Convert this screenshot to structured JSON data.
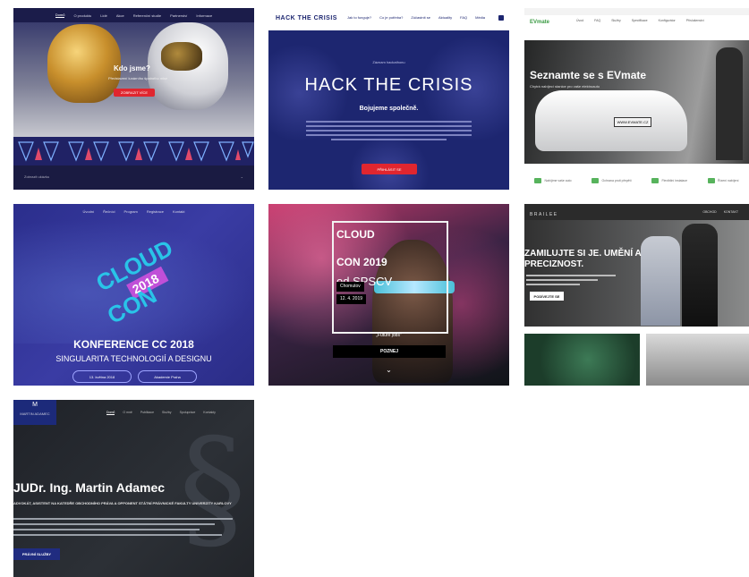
{
  "cards": [
    {
      "nav": [
        "Domů",
        "O produktu",
        "Lidé",
        "Akce",
        "Referenční studie",
        "Partnerství",
        "Informace"
      ],
      "title": "Kdo jsme?",
      "subtitle": "Představení lunárního špatného mise",
      "button": "ZOBRAZIT VÍCE",
      "footer": "Zobrazit ukázku"
    },
    {
      "logo": "HACK THE CRISIS",
      "nav": [
        "Jak to funguje?",
        "Co je potřeba?",
        "Zúčastnit se",
        "Aktuality",
        "FAQ",
        "Média"
      ],
      "kicker": "Záznam hackathonu",
      "title": "HACK THE CRISIS",
      "slogan": "Bojujeme společně.",
      "button": "PŘIHLÁSIT SE"
    },
    {
      "logo": "EVmate",
      "nav": [
        "Úvod",
        "FAQ",
        "Služby",
        "Specifikace",
        "Konfigurátor",
        "Příslušenství"
      ],
      "headline": "Seznamte se s EVmate",
      "subline": "Chytrá nabíjecí stanice pro vaše elektroauto",
      "plate": "WWW.EVMATE.CZ",
      "features": [
        "Nabíjíme vaše auto",
        "Ochrana proti přepětí",
        "Flexibilní instalace",
        "Řízení nabíjení"
      ],
      "accent": "#3a9a43"
    },
    {
      "nav": [
        "Úvodní",
        "Řečníci",
        "Program",
        "Registrace",
        "Kontakt"
      ],
      "logo_word1": "CLOUD",
      "logo_word2": "CON",
      "logo_year": "2018",
      "title": "KONFERENCE CC 2018",
      "subtitle": "SINGULARITA TECHNOLOGIÍ A DESIGNU",
      "pill1": "13. května 2018",
      "pill2": "Akademie Praha"
    },
    {
      "title1": "CLOUD",
      "title2": "CON 2019",
      "title3": "od SPSCV",
      "tag_place": "Chomutov",
      "tag_date": "12. 4. 2019",
      "quote": "„Future jobs\"",
      "button": "POZNEJ"
    },
    {
      "logo": "BRAILEE",
      "nav": [
        "OBCHOD",
        "KONTAKT"
      ],
      "headline": "ZAMILUJTE SI JE. UMĚNÍ A PRECIZNOST.",
      "button": "PODÍVEJTE SE"
    },
    {
      "logo_monogram": "M",
      "logo_name": "MARTIN ADAMEC",
      "nav": [
        "Domů",
        "O mně",
        "Publikace",
        "Služby",
        "Spolupráce",
        "Kontakty"
      ],
      "name": "JUDr. Ing. Martin Adamec",
      "role": "ADVOKÁT, ASISTENT NA KATEDŘE OBCHODNÍHO PRÁVA A OPPONENT STÁTNÍ PRÁVNICKÉ FAKULTY UNIVERZITY KARLOVY",
      "button": "PRÁVNÍ SLUŽBY"
    }
  ]
}
